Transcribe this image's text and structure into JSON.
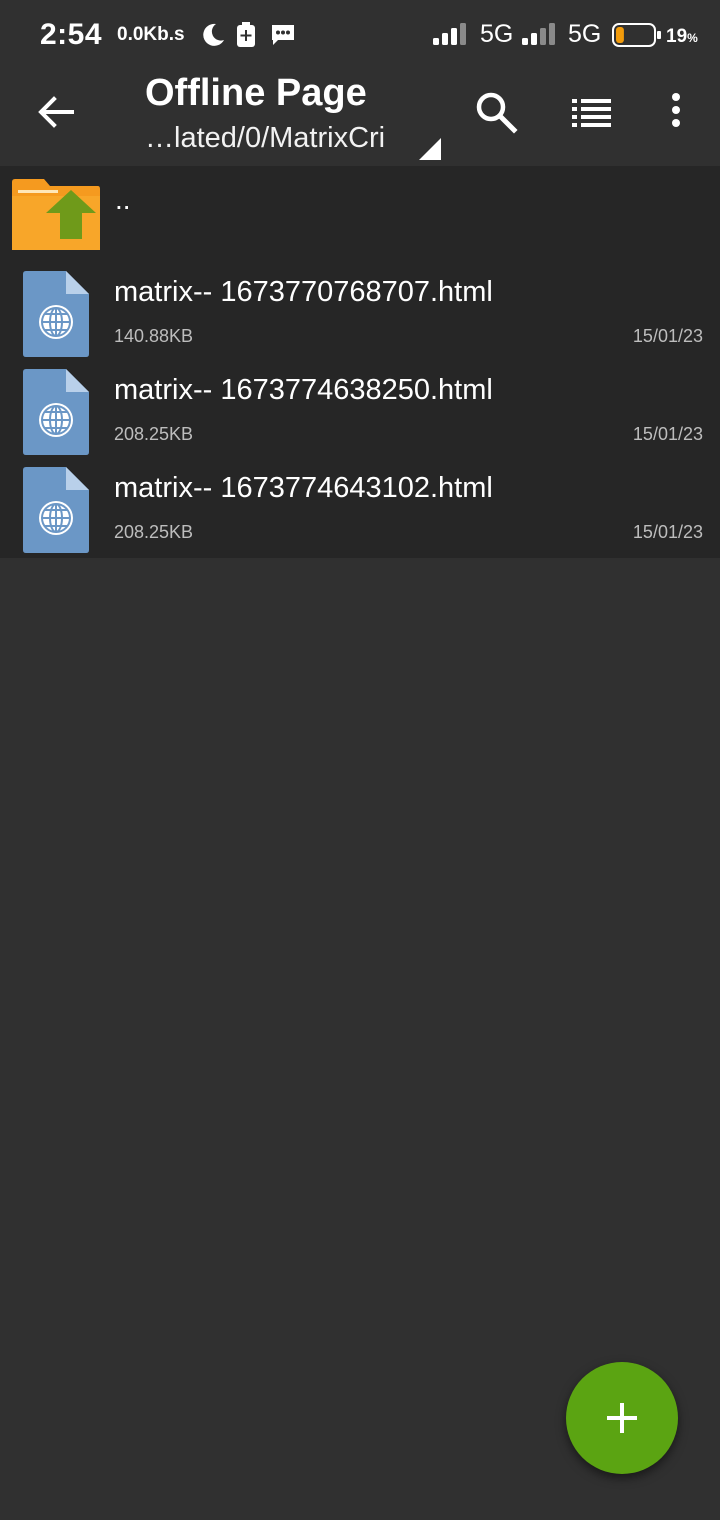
{
  "status_bar": {
    "time": "2:54",
    "net_speed": "0.0Kb.s",
    "sim1_type": "5G",
    "sim2_type": "5G",
    "battery_value": "19",
    "battery_unit": "%",
    "battery_level": 0.19,
    "icons": [
      "moon-icon",
      "battery-saver-icon",
      "message-icon",
      "signal-icon",
      "battery-icon"
    ]
  },
  "toolbar": {
    "title": "Offline Page",
    "path": "…lated/0/MatrixCri",
    "icons": [
      "back-arrow-icon",
      "dropdown-triangle-icon",
      "search-icon",
      "list-view-icon",
      "more-vert-icon"
    ]
  },
  "parent_dir": {
    "label": "..",
    "icon": "folder-up-icon"
  },
  "files": [
    {
      "name": "matrix-- 1673770768707.html",
      "size": "140.88KB",
      "date": "15/01/23",
      "icon": "html-file-icon"
    },
    {
      "name": "matrix-- 1673774638250.html",
      "size": "208.25KB",
      "date": "15/01/23",
      "icon": "html-file-icon"
    },
    {
      "name": "matrix-- 1673774643102.html",
      "size": "208.25KB",
      "date": "15/01/23",
      "icon": "html-file-icon"
    }
  ],
  "fab": {
    "icon": "plus-icon"
  },
  "colors": {
    "background": "#303030",
    "list_background": "#262626",
    "fab": "#5ba412",
    "folder": "#f59a1f",
    "folder_arrow": "#6f9a1a",
    "file_icon": "#6b97c6",
    "battery_low": "#f29b0b"
  }
}
